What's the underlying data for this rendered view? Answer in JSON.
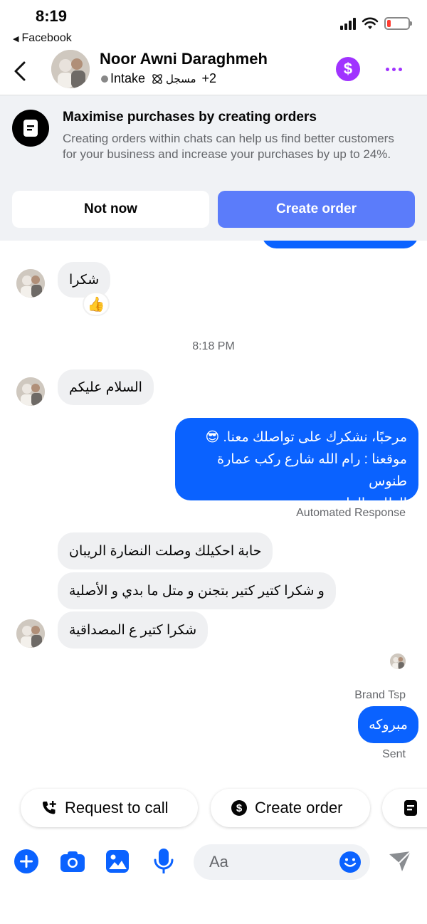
{
  "status_bar": {
    "time": "8:19",
    "back_app": "Facebook"
  },
  "header": {
    "contact_name": "Noor Awni Daraghmeh",
    "tag_intake": "Intake",
    "tag_registered": "مسجل",
    "tag_more": "+2"
  },
  "promo": {
    "title": "Maximise purchases by creating orders",
    "body": "Creating orders within chats can help us find better customers for your business and increase your purchases by up to 24%.",
    "not_now_label": "Not now",
    "create_order_label": "Create order"
  },
  "chat": {
    "msg_thanks": "شكرا",
    "reaction_emoji": "👍",
    "timestamp": "8:18 PM",
    "msg_salam": "السلام عليكم",
    "auto_reply_line1": "مرحبًا، نشكرك على تواصلك معنا. 😎",
    "auto_reply_line2": "موقعنا : رام الله شارع ركب عمارة طنوس",
    "auto_reply_line3": "الطابق الرابع",
    "automated_label": "Automated Response",
    "msg_glasses": "حابة احكيلك وصلت النضارة الريبان",
    "msg_beautiful": "و شكرا كتير كتير بتجنن و متل ما بدي و الأصلية",
    "msg_honesty": "شكرا كتير  ع المصداقية",
    "sender_name": "Brand Tsp",
    "msg_congrats": "مبروكه",
    "sent_label": "Sent"
  },
  "quick_actions": {
    "request_call": "Request to call",
    "create_order": "Create order"
  },
  "composer": {
    "placeholder": "Aa"
  },
  "colors": {
    "messenger_blue": "#0a62ff",
    "create_order_button": "#5b7cfa",
    "accent_purple": "#a033ff",
    "composer_blue": "#0a62ff"
  }
}
